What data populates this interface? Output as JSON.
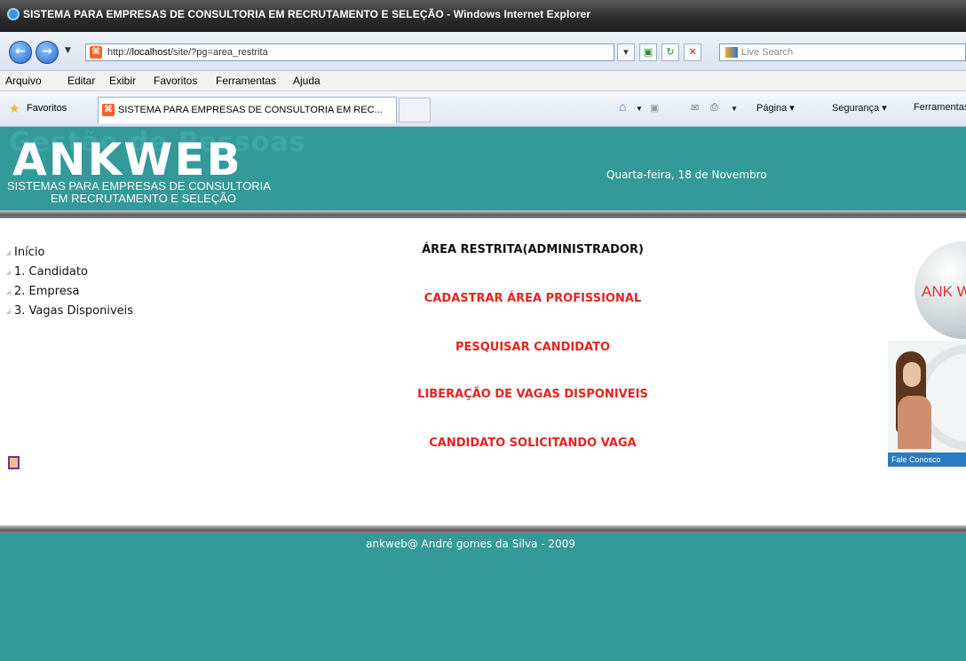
{
  "window": {
    "title": "SISTEMA PARA EMPRESAS DE CONSULTORIA EM RECRUTAMENTO E SELEÇÃO - Windows Internet Explorer"
  },
  "addressbar": {
    "back": "←",
    "forward": "→",
    "url_prefix": "http://",
    "url_host": "localhost",
    "url_path": "/site/?pg=area_restrita",
    "search_placeholder": "Live Search",
    "favicon": "⌘"
  },
  "menu": [
    "Arquivo",
    "Editar",
    "Exibir",
    "Favoritos",
    "Ferramentas",
    "Ajuda"
  ],
  "favorites": {
    "label": "Favoritos",
    "tab_title": "SISTEMA PARA EMPRESAS DE CONSULTORIA EM REC...",
    "commands": [
      "Página ▾",
      "Segurança ▾",
      "Ferramentas"
    ]
  },
  "header": {
    "ghost_text": "Gestão de Pessoas",
    "logo": "ANKWEB",
    "subtitle_line1": "SISTEMAS PARA EMPRESAS DE CONSULTORIA",
    "subtitle_line2": "EM RECRUTAMENTO E SELEÇÃO",
    "date": "Quarta-feira, 18 de Novembro"
  },
  "leftnav": [
    "Início",
    "1. Candidato",
    "2. Empresa",
    "3. Vagas Disponiveis"
  ],
  "main": {
    "title": "ÁREA RESTRITA(ADMINISTRADOR)",
    "links": [
      "CADASTRAR ÁREA PROFISSIONAL",
      "PESQUISAR CANDIDATO",
      "LIBERAÇÃO DE VAGAS DISPONIVEIS",
      "CANDIDATO SOLICITANDO VAGA"
    ]
  },
  "sidebar": {
    "bubble_text": "ANK W",
    "contact_label": "Fale Conosco"
  },
  "footer": {
    "credit": "ankweb@ André gomes da Silva - 2009"
  },
  "colors": {
    "teal": "#339999",
    "link_red": "#e5241f"
  }
}
